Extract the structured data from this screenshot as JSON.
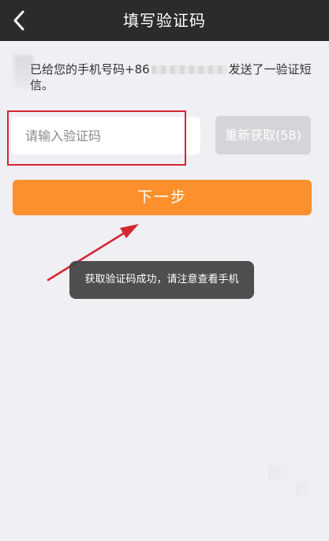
{
  "header": {
    "title": "填写验证码",
    "back_icon": "chevron-left-icon"
  },
  "info": {
    "text_prefix": "已给您的手机号码+86",
    "text_suffix": "发送了一验证短信。"
  },
  "code_input": {
    "placeholder": "请输入验证码",
    "value": ""
  },
  "resend_button": {
    "label": "重新获取(58)"
  },
  "next_button": {
    "label": "下一步"
  },
  "toast": {
    "text": "获取验证码成功，请注意查看手机"
  },
  "colors": {
    "header_bg": "#2b2b2b",
    "page_bg": "#efeff4",
    "primary": "#fb902c",
    "disabled": "#d5d5d9",
    "annotation": "#d42632"
  }
}
